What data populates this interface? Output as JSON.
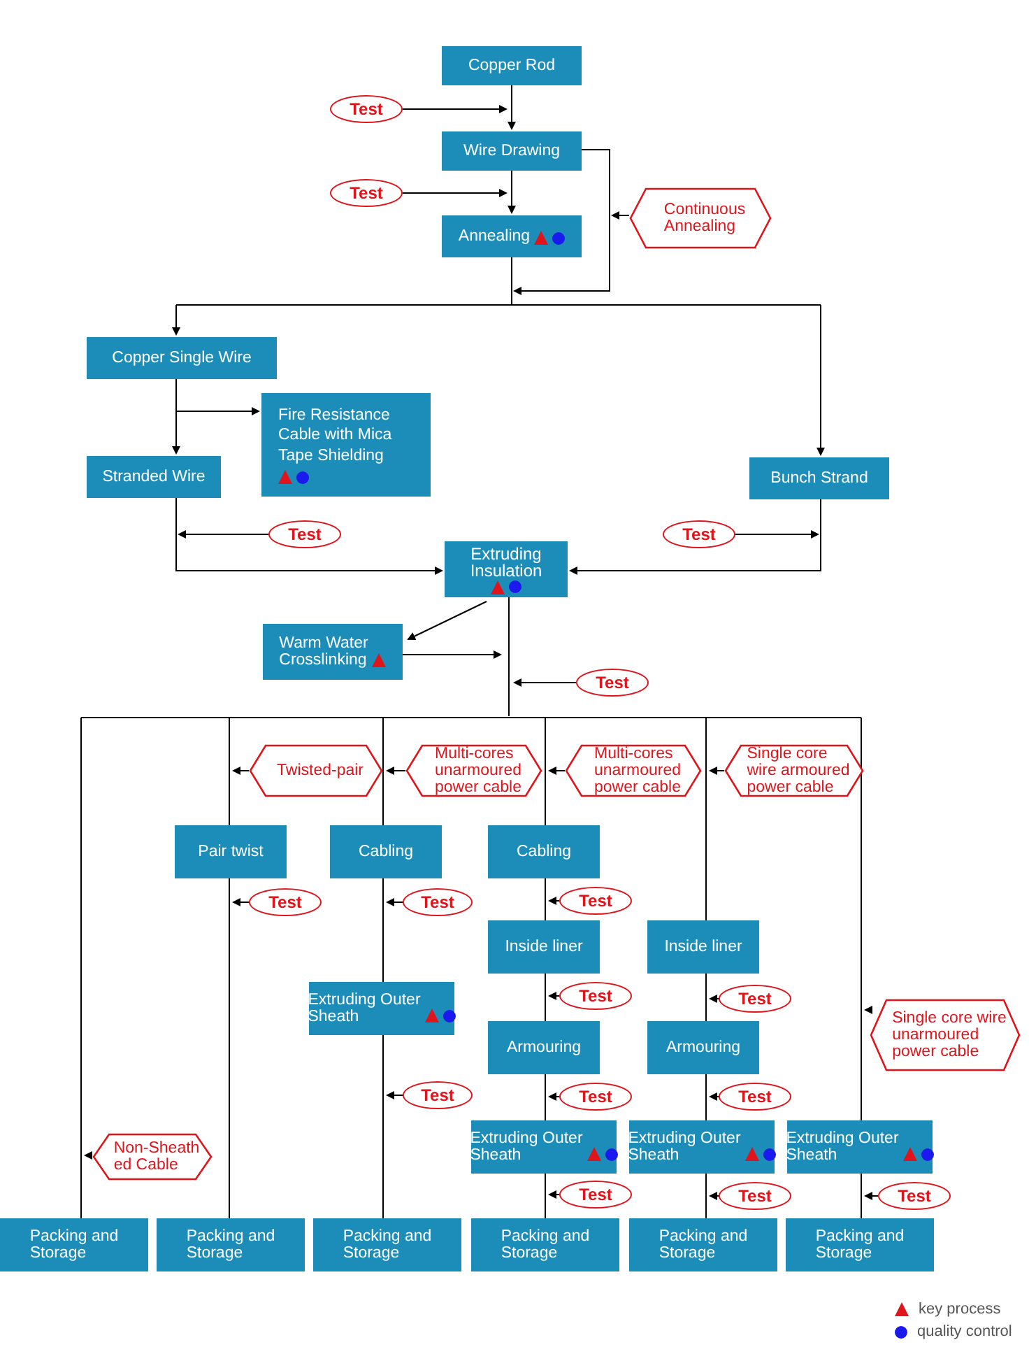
{
  "nodes": [
    {
      "text": "Copper Rod",
      "key_process": false,
      "quality_control": false
    },
    {
      "text": "Wire Drawing",
      "key_process": false,
      "quality_control": false
    },
    {
      "text": "Annealing",
      "key_process": true,
      "quality_control": true
    },
    {
      "text": "Copper Single Wire",
      "key_process": false,
      "quality_control": false
    },
    {
      "text": "Fire Resistance\nCable with Mica\nTape Shielding",
      "key_process": true,
      "quality_control": true
    },
    {
      "text": "Stranded Wire",
      "key_process": false,
      "quality_control": false
    },
    {
      "text": "Bunch Strand",
      "key_process": false,
      "quality_control": false
    },
    {
      "text": "Extruding\nInsulation",
      "key_process": true,
      "quality_control": true
    },
    {
      "text": "Warm Water\nCrosslinking",
      "key_process": true,
      "quality_control": false
    },
    {
      "text": "Pair twist",
      "key_process": false,
      "quality_control": false
    },
    {
      "text": "Cabling",
      "key_process": false,
      "quality_control": false
    },
    {
      "text": "Cabling",
      "key_process": false,
      "quality_control": false
    },
    {
      "text": "Inside liner",
      "key_process": false,
      "quality_control": false
    },
    {
      "text": "Inside liner",
      "key_process": false,
      "quality_control": false
    },
    {
      "text": "Extruding Outer\nSheath",
      "key_process": true,
      "quality_control": true
    },
    {
      "text": "Armouring",
      "key_process": false,
      "quality_control": false
    },
    {
      "text": "Armouring",
      "key_process": false,
      "quality_control": false
    },
    {
      "text": "Extruding Outer\nSheath",
      "key_process": true,
      "quality_control": true
    },
    {
      "text": "Extruding Outer\nSheath",
      "key_process": true,
      "quality_control": true
    },
    {
      "text": "Extruding Outer\nSheath",
      "key_process": true,
      "quality_control": true
    },
    {
      "text": "Packing and\nStorage",
      "key_process": false,
      "quality_control": false
    },
    {
      "text": "Packing and\nStorage",
      "key_process": false,
      "quality_control": false
    },
    {
      "text": "Packing and\nStorage",
      "key_process": false,
      "quality_control": false
    },
    {
      "text": "Packing and\nStorage",
      "key_process": false,
      "quality_control": false
    },
    {
      "text": "Packing and\nStorage",
      "key_process": false,
      "quality_control": false
    },
    {
      "text": "Packing and\nStorage",
      "key_process": false,
      "quality_control": false
    }
  ],
  "labels": [
    {
      "kind": "test",
      "text": "Test"
    },
    {
      "kind": "test",
      "text": "Test"
    },
    {
      "kind": "condition",
      "text": "Continuous\nAnnealing"
    },
    {
      "kind": "test",
      "text": "Test"
    },
    {
      "kind": "test",
      "text": "Test"
    },
    {
      "kind": "test",
      "text": "Test"
    },
    {
      "kind": "condition",
      "text": "Twisted-pair"
    },
    {
      "kind": "condition",
      "text": "Multi-cores\nunarmoured\npower cable"
    },
    {
      "kind": "condition",
      "text": "Multi-cores\nunarmoured\npower cable"
    },
    {
      "kind": "condition",
      "text": "Single core\nwire armoured\npower cable"
    },
    {
      "kind": "test",
      "text": "Test"
    },
    {
      "kind": "test",
      "text": "Test"
    },
    {
      "kind": "test",
      "text": "Test"
    },
    {
      "kind": "test",
      "text": "Test"
    },
    {
      "kind": "test",
      "text": "Test"
    },
    {
      "kind": "condition",
      "text": "Single core wire\nunarmoured\npower cable"
    },
    {
      "kind": "test",
      "text": "Test"
    },
    {
      "kind": "test",
      "text": "Test"
    },
    {
      "kind": "test",
      "text": "Test"
    },
    {
      "kind": "condition",
      "text": "Non-Sheath\ned Cable"
    },
    {
      "kind": "test",
      "text": "Test"
    },
    {
      "kind": "test",
      "text": "Test"
    },
    {
      "kind": "test",
      "text": "Test"
    }
  ],
  "legend": [
    {
      "kind": "key_process",
      "text": "key process"
    },
    {
      "kind": "quality_control",
      "text": "quality control"
    }
  ]
}
